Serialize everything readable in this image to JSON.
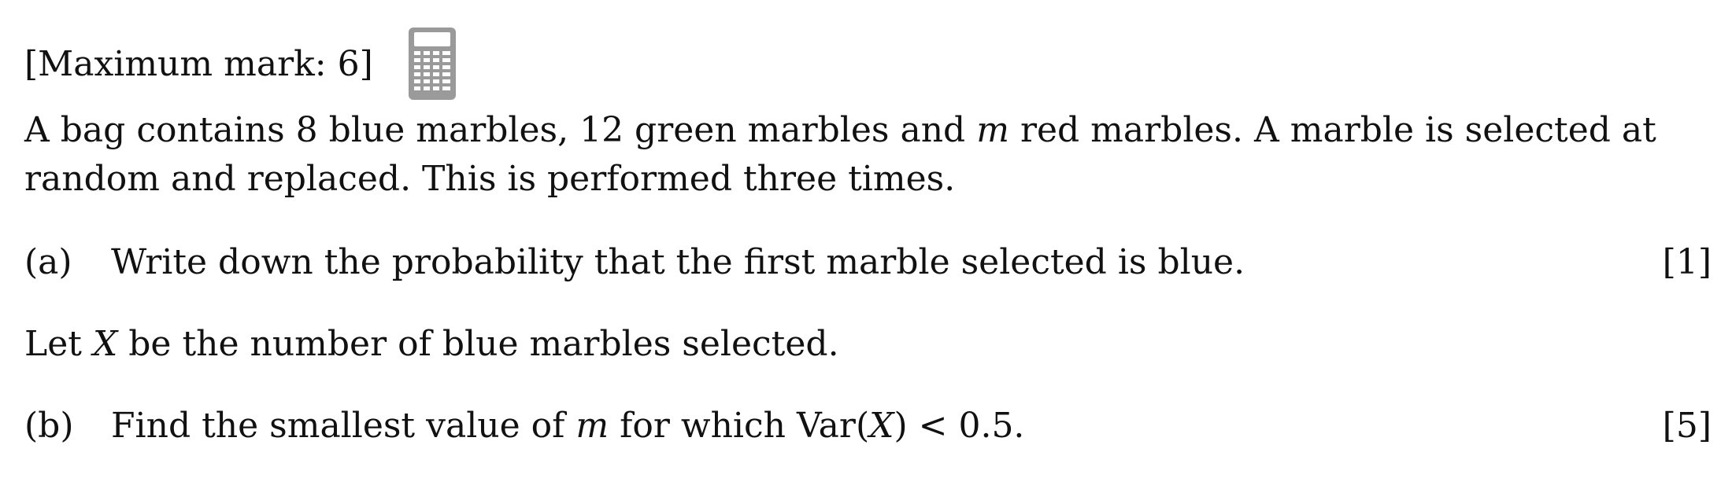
{
  "header": {
    "max_mark": "[Maximum mark: 6]",
    "calculator_icon": "calculator-icon"
  },
  "stem": {
    "line1_part1": "A bag contains 8 blue marbles, 12 green marbles and ",
    "line1_var": "m",
    "line1_part2": " red marbles. A marble is selected at",
    "line2": "random and replaced. This is performed three times."
  },
  "question_a": {
    "label": "(a)",
    "text": "Write down the probability that the first marble selected is blue.",
    "marks": "[1]"
  },
  "intro_b": {
    "part1": "Let ",
    "var": "X",
    "part2": " be the number of blue marbles selected."
  },
  "question_b": {
    "label": "(b)",
    "text_part1": "Find the smallest value of ",
    "var_m": "m",
    "text_part2": " for which Var(",
    "var_x": "X",
    "text_part3": ") < 0.5.",
    "marks": "[5]"
  },
  "colors": {
    "text": "#111111",
    "icon_gray": "#9a9a9a"
  }
}
